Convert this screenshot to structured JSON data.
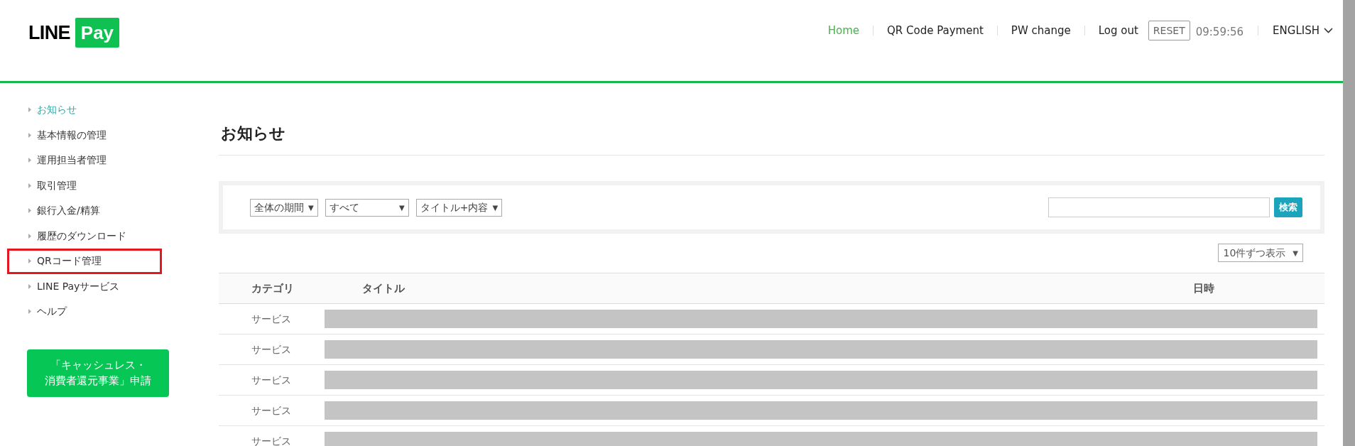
{
  "header": {
    "logo": {
      "word": "LINE",
      "badge": "Pay"
    },
    "nav": [
      {
        "label": "Home",
        "selected": true
      },
      {
        "label": "QR Code Payment",
        "selected": false
      },
      {
        "label": "PW change",
        "selected": false
      },
      {
        "label": "Log out",
        "selected": false
      }
    ],
    "reset_button": "RESET",
    "time": "09:59:56",
    "language": "ENGLISH"
  },
  "sidebar": {
    "items": [
      {
        "label": "お知らせ",
        "selected": true,
        "annotated": false
      },
      {
        "label": "基本情報の管理",
        "selected": false,
        "annotated": false
      },
      {
        "label": "運用担当者管理",
        "selected": false,
        "annotated": false
      },
      {
        "label": "取引管理",
        "selected": false,
        "annotated": false
      },
      {
        "label": "銀行入金/精算",
        "selected": false,
        "annotated": false
      },
      {
        "label": "履歴のダウンロード",
        "selected": false,
        "annotated": false
      },
      {
        "label": "QRコード管理",
        "selected": false,
        "annotated": true
      },
      {
        "label": "LINE Payサービス",
        "selected": false,
        "annotated": false
      },
      {
        "label": "ヘルプ",
        "selected": false,
        "annotated": false
      }
    ],
    "cta_button": [
      "「キャッシュレス・",
      "消費者還元事業」申請"
    ]
  },
  "page_title": "お知らせ",
  "filters": {
    "selects": [
      {
        "value": "全体の期間",
        "arrow": "▼"
      },
      {
        "value": "すべて",
        "arrow": "▼"
      },
      {
        "value": "タイトル+内容",
        "arrow": "▼"
      }
    ],
    "search_button": "検索"
  },
  "page_size": {
    "value": "10件ずつ表示",
    "arrow": "▼"
  },
  "table": {
    "columns": [
      "カテゴリ",
      "タイトル",
      "日時"
    ],
    "rows": [
      {
        "category": "サービス"
      },
      {
        "category": "サービス"
      },
      {
        "category": "サービス"
      },
      {
        "category": "サービス"
      },
      {
        "category": "サービス"
      }
    ]
  }
}
